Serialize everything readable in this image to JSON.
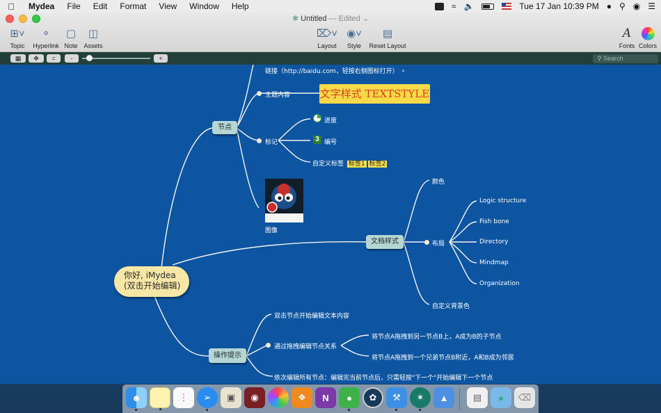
{
  "menubar": {
    "app_name": "Mydea",
    "items": [
      "File",
      "Edit",
      "Format",
      "View",
      "Window",
      "Help"
    ],
    "clock": "Tue 17 Jan  10:39 PM"
  },
  "window": {
    "title": "Untitled",
    "status": "— Edited"
  },
  "toolbar": {
    "topic": "Topic",
    "hyperlink": "Hyperlink",
    "note": "Note",
    "assets": "Assets",
    "layout": "Layout",
    "style": "Style",
    "reset_layout": "Reset Layout",
    "fonts": "Fonts",
    "colors": "Colors"
  },
  "subbar": {
    "eq": "=",
    "minus": "-",
    "plus": "+",
    "search_placeholder": "Search"
  },
  "mindmap": {
    "root": {
      "line1": "你好, iMydea",
      "line2": "(双击开始编辑)"
    },
    "node_jiedian": {
      "label": "节点",
      "link": "链接（http://baidu.com，轻按右侧图标打开）",
      "topic_content": "主题内容",
      "textstyle": "文字样式 TEXTSTYLE",
      "mark": "标记",
      "progress": "进度",
      "number": "编号",
      "number_badge": "3",
      "custom_tag": "自定义标签",
      "tag1": "标签1",
      "tag2": "标签2",
      "image": "图像"
    },
    "node_style": {
      "label": "文档样式",
      "color": "颜色",
      "layout": "布局",
      "layout_options": [
        "Logic structure",
        "Fish bone",
        "Directory",
        "Mindmap",
        "Organization"
      ],
      "bg": "自定义背景色"
    },
    "node_tips": {
      "label": "操作提示",
      "dbl": "双击节点开始编辑文本内容",
      "drag": "通过拖拽编辑节点关系",
      "drag1": "将节点A拖拽到另一节点B上，A成为B的子节点",
      "drag2": "将节点A拖拽到一个兄弟节点B附近，A和B成为邻居",
      "seq": "依次编辑所有节点：编辑完当前节点后，只需轻按\"下一个\"开始编辑下一个节点"
    }
  },
  "colors": {
    "canvas": "#0d55a1",
    "node": "#b5d6d3",
    "root": "#f7e7a7",
    "highlight": "#f8d94a"
  }
}
